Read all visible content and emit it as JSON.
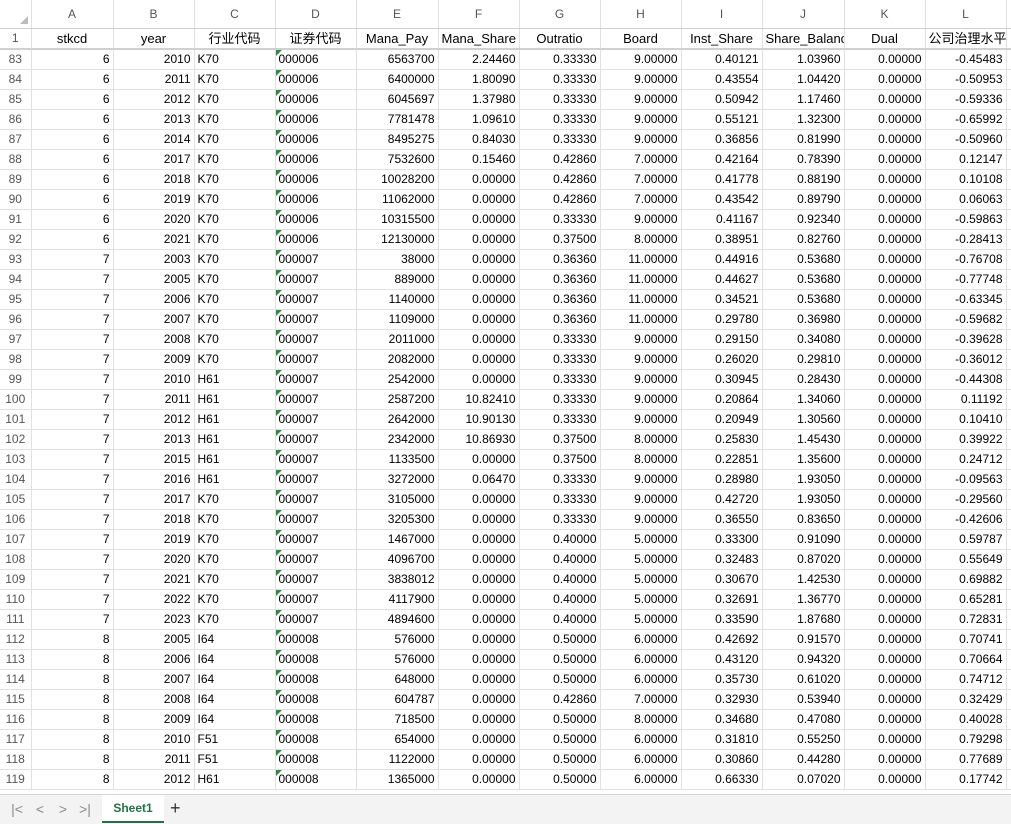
{
  "columns": [
    "A",
    "B",
    "C",
    "D",
    "E",
    "F",
    "G",
    "H",
    "I",
    "J",
    "K",
    "L"
  ],
  "header_row": {
    "row_number": "1",
    "cells": [
      "stkcd",
      "year",
      "行业代码",
      "证券代码",
      "Mana_Pay",
      "Mana_Share",
      "Outratio",
      "Board",
      "Inst_Share",
      "Share_Balance",
      "Dual",
      "公司治理水平"
    ]
  },
  "rows": [
    {
      "n": "83",
      "c": [
        "6",
        "2010",
        "K70",
        "000006",
        "6563700",
        "2.24460",
        "0.33330",
        "9.00000",
        "0.40121",
        "1.03960",
        "0.00000",
        "-0.45483"
      ]
    },
    {
      "n": "84",
      "c": [
        "6",
        "2011",
        "K70",
        "000006",
        "6400000",
        "1.80090",
        "0.33330",
        "9.00000",
        "0.43554",
        "1.04420",
        "0.00000",
        "-0.50953"
      ]
    },
    {
      "n": "85",
      "c": [
        "6",
        "2012",
        "K70",
        "000006",
        "6045697",
        "1.37980",
        "0.33330",
        "9.00000",
        "0.50942",
        "1.17460",
        "0.00000",
        "-0.59336"
      ]
    },
    {
      "n": "86",
      "c": [
        "6",
        "2013",
        "K70",
        "000006",
        "7781478",
        "1.09610",
        "0.33330",
        "9.00000",
        "0.55121",
        "1.32300",
        "0.00000",
        "-0.65992"
      ]
    },
    {
      "n": "87",
      "c": [
        "6",
        "2014",
        "K70",
        "000006",
        "8495275",
        "0.84030",
        "0.33330",
        "9.00000",
        "0.36856",
        "0.81990",
        "0.00000",
        "-0.50960"
      ]
    },
    {
      "n": "88",
      "c": [
        "6",
        "2017",
        "K70",
        "000006",
        "7532600",
        "0.15460",
        "0.42860",
        "7.00000",
        "0.42164",
        "0.78390",
        "0.00000",
        "0.12147"
      ]
    },
    {
      "n": "89",
      "c": [
        "6",
        "2018",
        "K70",
        "000006",
        "10028200",
        "0.00000",
        "0.42860",
        "7.00000",
        "0.41778",
        "0.88190",
        "0.00000",
        "0.10108"
      ]
    },
    {
      "n": "90",
      "c": [
        "6",
        "2019",
        "K70",
        "000006",
        "11062000",
        "0.00000",
        "0.42860",
        "7.00000",
        "0.43542",
        "0.89790",
        "0.00000",
        "0.06063"
      ]
    },
    {
      "n": "91",
      "c": [
        "6",
        "2020",
        "K70",
        "000006",
        "10315500",
        "0.00000",
        "0.33330",
        "9.00000",
        "0.41167",
        "0.92340",
        "0.00000",
        "-0.59863"
      ]
    },
    {
      "n": "92",
      "c": [
        "6",
        "2021",
        "K70",
        "000006",
        "12130000",
        "0.00000",
        "0.37500",
        "8.00000",
        "0.38951",
        "0.82760",
        "0.00000",
        "-0.28413"
      ]
    },
    {
      "n": "93",
      "c": [
        "7",
        "2003",
        "K70",
        "000007",
        "38000",
        "0.00000",
        "0.36360",
        "11.00000",
        "0.44916",
        "0.53680",
        "0.00000",
        "-0.76708"
      ]
    },
    {
      "n": "94",
      "c": [
        "7",
        "2005",
        "K70",
        "000007",
        "889000",
        "0.00000",
        "0.36360",
        "11.00000",
        "0.44627",
        "0.53680",
        "0.00000",
        "-0.77748"
      ]
    },
    {
      "n": "95",
      "c": [
        "7",
        "2006",
        "K70",
        "000007",
        "1140000",
        "0.00000",
        "0.36360",
        "11.00000",
        "0.34521",
        "0.53680",
        "0.00000",
        "-0.63345"
      ]
    },
    {
      "n": "96",
      "c": [
        "7",
        "2007",
        "K70",
        "000007",
        "1109000",
        "0.00000",
        "0.36360",
        "11.00000",
        "0.29780",
        "0.36980",
        "0.00000",
        "-0.59682"
      ]
    },
    {
      "n": "97",
      "c": [
        "7",
        "2008",
        "K70",
        "000007",
        "2011000",
        "0.00000",
        "0.33330",
        "9.00000",
        "0.29150",
        "0.34080",
        "0.00000",
        "-0.39628"
      ]
    },
    {
      "n": "98",
      "c": [
        "7",
        "2009",
        "K70",
        "000007",
        "2082000",
        "0.00000",
        "0.33330",
        "9.00000",
        "0.26020",
        "0.29810",
        "0.00000",
        "-0.36012"
      ]
    },
    {
      "n": "99",
      "c": [
        "7",
        "2010",
        "H61",
        "000007",
        "2542000",
        "0.00000",
        "0.33330",
        "9.00000",
        "0.30945",
        "0.28430",
        "0.00000",
        "-0.44308"
      ]
    },
    {
      "n": "100",
      "c": [
        "7",
        "2011",
        "H61",
        "000007",
        "2587200",
        "10.82410",
        "0.33330",
        "9.00000",
        "0.20864",
        "1.34060",
        "0.00000",
        "0.11192"
      ]
    },
    {
      "n": "101",
      "c": [
        "7",
        "2012",
        "H61",
        "000007",
        "2642000",
        "10.90130",
        "0.33330",
        "9.00000",
        "0.20949",
        "1.30560",
        "0.00000",
        "0.10410"
      ]
    },
    {
      "n": "102",
      "c": [
        "7",
        "2013",
        "H61",
        "000007",
        "2342000",
        "10.86930",
        "0.37500",
        "8.00000",
        "0.25830",
        "1.45430",
        "0.00000",
        "0.39922"
      ]
    },
    {
      "n": "103",
      "c": [
        "7",
        "2015",
        "H61",
        "000007",
        "1133500",
        "0.00000",
        "0.37500",
        "8.00000",
        "0.22851",
        "1.35600",
        "0.00000",
        "0.24712"
      ]
    },
    {
      "n": "104",
      "c": [
        "7",
        "2016",
        "H61",
        "000007",
        "3272000",
        "0.06470",
        "0.33330",
        "9.00000",
        "0.28980",
        "1.93050",
        "0.00000",
        "-0.09563"
      ]
    },
    {
      "n": "105",
      "c": [
        "7",
        "2017",
        "K70",
        "000007",
        "3105000",
        "0.00000",
        "0.33330",
        "9.00000",
        "0.42720",
        "1.93050",
        "0.00000",
        "-0.29560"
      ]
    },
    {
      "n": "106",
      "c": [
        "7",
        "2018",
        "K70",
        "000007",
        "3205300",
        "0.00000",
        "0.33330",
        "9.00000",
        "0.36550",
        "0.83650",
        "0.00000",
        "-0.42606"
      ]
    },
    {
      "n": "107",
      "c": [
        "7",
        "2019",
        "K70",
        "000007",
        "1467000",
        "0.00000",
        "0.40000",
        "5.00000",
        "0.33300",
        "0.91090",
        "0.00000",
        "0.59787"
      ]
    },
    {
      "n": "108",
      "c": [
        "7",
        "2020",
        "K70",
        "000007",
        "4096700",
        "0.00000",
        "0.40000",
        "5.00000",
        "0.32483",
        "0.87020",
        "0.00000",
        "0.55649"
      ]
    },
    {
      "n": "109",
      "c": [
        "7",
        "2021",
        "K70",
        "000007",
        "3838012",
        "0.00000",
        "0.40000",
        "5.00000",
        "0.30670",
        "1.42530",
        "0.00000",
        "0.69882"
      ]
    },
    {
      "n": "110",
      "c": [
        "7",
        "2022",
        "K70",
        "000007",
        "4117900",
        "0.00000",
        "0.40000",
        "5.00000",
        "0.32691",
        "1.36770",
        "0.00000",
        "0.65281"
      ]
    },
    {
      "n": "111",
      "c": [
        "7",
        "2023",
        "K70",
        "000007",
        "4894600",
        "0.00000",
        "0.40000",
        "5.00000",
        "0.33590",
        "1.87680",
        "0.00000",
        "0.72831"
      ]
    },
    {
      "n": "112",
      "c": [
        "8",
        "2005",
        "I64",
        "000008",
        "576000",
        "0.00000",
        "0.50000",
        "6.00000",
        "0.42692",
        "0.91570",
        "0.00000",
        "0.70741"
      ]
    },
    {
      "n": "113",
      "c": [
        "8",
        "2006",
        "I64",
        "000008",
        "576000",
        "0.00000",
        "0.50000",
        "6.00000",
        "0.43120",
        "0.94320",
        "0.00000",
        "0.70664"
      ]
    },
    {
      "n": "114",
      "c": [
        "8",
        "2007",
        "I64",
        "000008",
        "648000",
        "0.00000",
        "0.50000",
        "6.00000",
        "0.35730",
        "0.61020",
        "0.00000",
        "0.74712"
      ]
    },
    {
      "n": "115",
      "c": [
        "8",
        "2008",
        "I64",
        "000008",
        "604787",
        "0.00000",
        "0.42860",
        "7.00000",
        "0.32930",
        "0.53940",
        "0.00000",
        "0.32429"
      ]
    },
    {
      "n": "116",
      "c": [
        "8",
        "2009",
        "I64",
        "000008",
        "718500",
        "0.00000",
        "0.50000",
        "8.00000",
        "0.34680",
        "0.47080",
        "0.00000",
        "0.40028"
      ]
    },
    {
      "n": "117",
      "c": [
        "8",
        "2010",
        "F51",
        "000008",
        "654000",
        "0.00000",
        "0.50000",
        "6.00000",
        "0.31810",
        "0.55250",
        "0.00000",
        "0.79298"
      ]
    },
    {
      "n": "118",
      "c": [
        "8",
        "2011",
        "F51",
        "000008",
        "1122000",
        "0.00000",
        "0.50000",
        "6.00000",
        "0.30860",
        "0.44280",
        "0.00000",
        "0.77689"
      ]
    },
    {
      "n": "119",
      "c": [
        "8",
        "2012",
        "H61",
        "000008",
        "1365000",
        "0.00000",
        "0.50000",
        "6.00000",
        "0.66330",
        "0.07020",
        "0.00000",
        "0.17742"
      ]
    }
  ],
  "tabs": {
    "sheet_name": "Sheet1",
    "add_symbol": "+",
    "nav_first": "|<",
    "nav_prev": "<",
    "nav_next": ">",
    "nav_last": ">|"
  },
  "colors": {
    "accent": "#217346",
    "text_flag": "#2e8b3e",
    "gridline": "#e1e1e1"
  }
}
